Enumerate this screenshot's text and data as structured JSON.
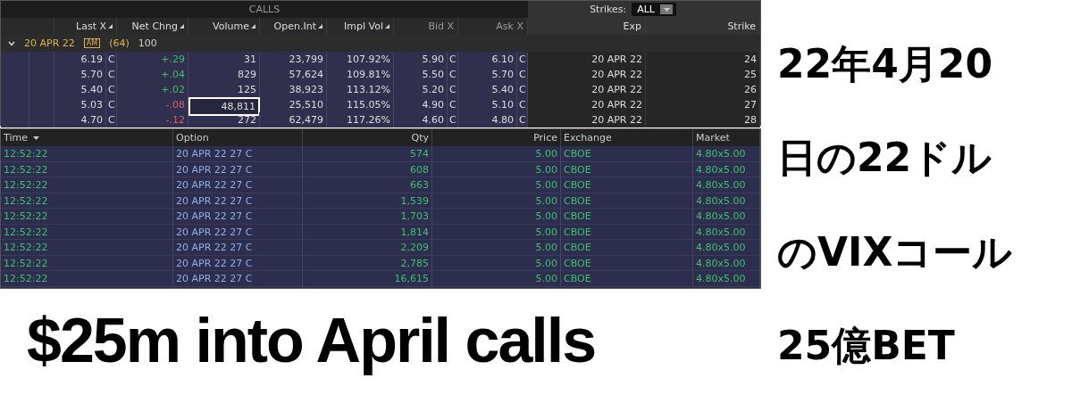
{
  "options_chain": {
    "section_title": "CALLS",
    "strikes_label": "Strikes:",
    "strikes_value": "ALL",
    "columns": [
      {
        "label": "Last X",
        "sortable": true
      },
      {
        "label": "Net Chng",
        "sortable": true
      },
      {
        "label": "Volume",
        "sortable": true
      },
      {
        "label": "Open.Int",
        "sortable": true
      },
      {
        "label": "Impl Vol",
        "sortable": true
      },
      {
        "label": "Bid X",
        "sortable": false
      },
      {
        "label": "Ask X",
        "sortable": false
      },
      {
        "label": "Exp",
        "sortable": false
      },
      {
        "label": "Strike",
        "sortable": false
      }
    ],
    "group": {
      "expiration": "20 APR 22",
      "session_badge": "AM",
      "count": "(64)",
      "multiplier": "100",
      "expanded": true
    },
    "rows": [
      {
        "last": "6.19",
        "last_exchange": "C",
        "net_change": "+.29",
        "negative": false,
        "volume": "31",
        "open_interest": "23,799",
        "implied_vol": "107.92%",
        "bid": "5.90",
        "bid_exchange": "C",
        "ask": "6.10",
        "ask_exchange": "C",
        "exp": "20 APR 22",
        "strike": "24",
        "highlighted": false
      },
      {
        "last": "5.70",
        "last_exchange": "C",
        "net_change": "+.04",
        "negative": false,
        "volume": "829",
        "open_interest": "57,624",
        "implied_vol": "109.81%",
        "bid": "5.50",
        "bid_exchange": "C",
        "ask": "5.70",
        "ask_exchange": "C",
        "exp": "20 APR 22",
        "strike": "25",
        "highlighted": false
      },
      {
        "last": "5.40",
        "last_exchange": "C",
        "net_change": "+.02",
        "negative": false,
        "volume": "125",
        "open_interest": "38,923",
        "implied_vol": "113.12%",
        "bid": "5.20",
        "bid_exchange": "C",
        "ask": "5.40",
        "ask_exchange": "C",
        "exp": "20 APR 22",
        "strike": "26",
        "highlighted": false
      },
      {
        "last": "5.03",
        "last_exchange": "C",
        "net_change": "-.08",
        "negative": true,
        "volume": "48,811",
        "open_interest": "25,510",
        "implied_vol": "115.05%",
        "bid": "4.90",
        "bid_exchange": "C",
        "ask": "5.10",
        "ask_exchange": "C",
        "exp": "20 APR 22",
        "strike": "27",
        "highlighted": true
      },
      {
        "last": "4.70",
        "last_exchange": "C",
        "net_change": "-.12",
        "negative": true,
        "volume": "272",
        "open_interest": "62,479",
        "implied_vol": "117.26%",
        "bid": "4.60",
        "bid_exchange": "C",
        "ask": "4.80",
        "ask_exchange": "C",
        "exp": "20 APR 22",
        "strike": "28",
        "highlighted": false
      }
    ]
  },
  "time_and_sales": {
    "columns": [
      {
        "label": "Time",
        "sorted": true
      },
      {
        "label": "Option",
        "sorted": false
      },
      {
        "label": "Qty",
        "sorted": false
      },
      {
        "label": "Price",
        "sorted": false
      },
      {
        "label": "Exchange",
        "sorted": false
      },
      {
        "label": "Market",
        "sorted": false
      }
    ],
    "rows": [
      {
        "time": "12:52:22",
        "option": "20 APR 22 27 C",
        "qty": "574",
        "price": "5.00",
        "exchange": "CBOE",
        "market": "4.80x5.00"
      },
      {
        "time": "12:52:22",
        "option": "20 APR 22 27 C",
        "qty": "608",
        "price": "5.00",
        "exchange": "CBOE",
        "market": "4.80x5.00"
      },
      {
        "time": "12:52:22",
        "option": "20 APR 22 27 C",
        "qty": "663",
        "price": "5.00",
        "exchange": "CBOE",
        "market": "4.80x5.00"
      },
      {
        "time": "12:52:22",
        "option": "20 APR 22 27 C",
        "qty": "1,539",
        "price": "5.00",
        "exchange": "CBOE",
        "market": "4.80x5.00"
      },
      {
        "time": "12:52:22",
        "option": "20 APR 22 27 C",
        "qty": "1,703",
        "price": "5.00",
        "exchange": "CBOE",
        "market": "4.80x5.00"
      },
      {
        "time": "12:52:22",
        "option": "20 APR 22 27 C",
        "qty": "1,814",
        "price": "5.00",
        "exchange": "CBOE",
        "market": "4.80x5.00"
      },
      {
        "time": "12:52:22",
        "option": "20 APR 22 27 C",
        "qty": "2,209",
        "price": "5.00",
        "exchange": "CBOE",
        "market": "4.80x5.00"
      },
      {
        "time": "12:52:22",
        "option": "20 APR 22 27 C",
        "qty": "2,785",
        "price": "5.00",
        "exchange": "CBOE",
        "market": "4.80x5.00"
      },
      {
        "time": "12:52:22",
        "option": "20 APR 22 27 C",
        "qty": "16,615",
        "price": "5.00",
        "exchange": "CBOE",
        "market": "4.80x5.00"
      }
    ]
  },
  "caption": "$25m into April calls",
  "side_caption_lines": [
    "22年4月20",
    "日の22ドル",
    "のVIXコール",
    "25億BET"
  ]
}
